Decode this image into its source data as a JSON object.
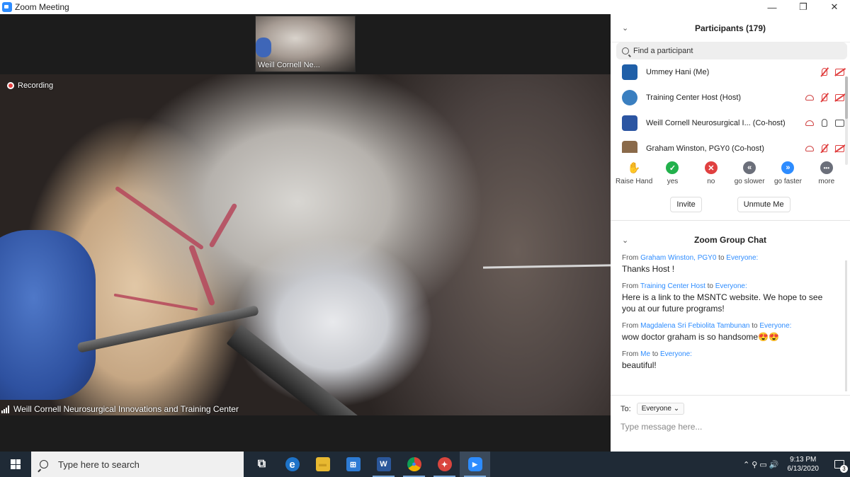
{
  "window": {
    "title": "Zoom Meeting",
    "controls": [
      "—",
      "❐",
      "✕"
    ]
  },
  "video": {
    "thumbnail_label": "Weill Cornell Ne...",
    "recording_label": "Recording",
    "speaker_name": "Weill Cornell Neurosurgical Innovations and Training Center"
  },
  "participants": {
    "title": "Participants (179)",
    "search_placeholder": "Find a participant",
    "list": [
      {
        "name": "Ummey Hani (Me)",
        "avatar_color": "#1f5fa8",
        "icons": [
          "mic-muted-icon",
          "video-off-icon"
        ]
      },
      {
        "name": "Training Center Host (Host)",
        "avatar_color": "#3a7fc0",
        "icons": [
          "cloud-icon",
          "mic-muted-icon",
          "video-off-icon"
        ]
      },
      {
        "name": "Weill Cornell Neurosurgical I... (Co-host)",
        "avatar_color": "#2b55a2",
        "icons": [
          "cloud-icon",
          "mic-icon",
          "video-icon"
        ]
      },
      {
        "name": "Graham Winston, PGY0 (Co-host)",
        "avatar_color": "#8a6a4a",
        "icons": [
          "cloud-icon",
          "mic-muted-icon",
          "video-off-icon"
        ]
      }
    ],
    "reactions": [
      {
        "label": "Raise Hand",
        "glyph": "✋",
        "color": "#2d8cff"
      },
      {
        "label": "yes",
        "glyph": "✓",
        "color": "#22b14c"
      },
      {
        "label": "no",
        "glyph": "✕",
        "color": "#e04040"
      },
      {
        "label": "go slower",
        "glyph": "«",
        "color": "#6b6f7a"
      },
      {
        "label": "go faster",
        "glyph": "»",
        "color": "#2d8cff"
      },
      {
        "label": "more",
        "glyph": "•••",
        "color": "#6b6f7a"
      }
    ],
    "invite_label": "Invite",
    "unmute_label": "Unmute Me"
  },
  "chat": {
    "title": "Zoom Group Chat",
    "messages": [
      {
        "from": "Graham Winston, PGY0",
        "to": "Everyone:",
        "text": "Thanks Host !"
      },
      {
        "from": "Training Center Host",
        "to": "Everyone:",
        "text": "Here is a link to the MSNTC website. We hope to see you at our future programs!"
      },
      {
        "from": "Magdalena Sri Febiolita Tambunan",
        "to": "Everyone:",
        "text": "wow doctor graham is so handsome😍😍"
      },
      {
        "from": "Me",
        "to": "Everyone:",
        "text": "beautiful!"
      }
    ],
    "from_word": "From",
    "to_word": "to",
    "to_label": "To:",
    "to_select": "Everyone ⌄",
    "input_placeholder": "Type message here..."
  },
  "taskbar": {
    "search_placeholder": "Type here to search",
    "apps": [
      {
        "name": "task-view",
        "glyph": "⧉",
        "color": "transparent"
      },
      {
        "name": "edge",
        "glyph": "e",
        "color": "#1e73c8"
      },
      {
        "name": "file-explorer",
        "glyph": "▬",
        "color": "#e8b931"
      },
      {
        "name": "store",
        "glyph": "⊞",
        "color": "#2d7bd4"
      },
      {
        "name": "word",
        "glyph": "W",
        "color": "#2b579a"
      },
      {
        "name": "chrome",
        "glyph": "●",
        "color": "#dd4b39"
      },
      {
        "name": "app",
        "glyph": "✦",
        "color": "#d9453e"
      },
      {
        "name": "zoom",
        "glyph": "▶",
        "color": "#2d8cff"
      }
    ],
    "tray_icons": "⌃ ⚲ ▭ 🔊",
    "time": "9:13 PM",
    "date": "6/13/2020",
    "notifications": "3"
  }
}
